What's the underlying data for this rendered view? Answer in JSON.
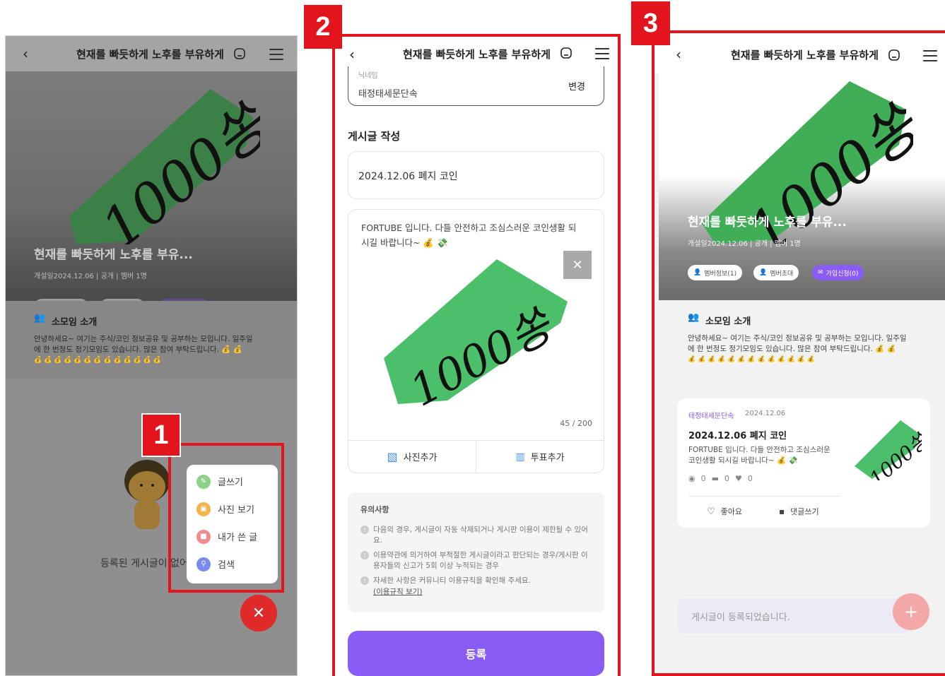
{
  "header": {
    "back": "‹",
    "title": "현재를 빠듯하게 노후를 부유하게"
  },
  "steps": [
    "1",
    "2",
    "3"
  ],
  "banner": {
    "title": "현재를 빠듯하게 노후를 부유...",
    "meta": "개설일2024.12.06  |  공개  |  멤버 1명",
    "member_info": "멤버정보(1)",
    "member_invite": "멤버초대",
    "join_request": "가입신청(0)"
  },
  "intro": {
    "title": "소모임 소개",
    "desc_line1": "안녕하세요~ 여기는 주식/코인 정보공유 및 공부하는 모입니다. 일주일",
    "desc_line2": "에 한 번정도 정기모임도 있습니다. 많은 참여 부탁드립니다. 💰 💰",
    "desc_line3": "💰 💰 💰 💰 💰 💰 💰 💰 💰 💰 💰 💰 💰"
  },
  "panel1": {
    "empty_text": "등록된 게시글이 없어",
    "fab_menu": [
      {
        "label": "글쓰기",
        "color": "#8fd18a",
        "glyph": "✎"
      },
      {
        "label": "사진 보기",
        "color": "#f6b24b",
        "glyph": "▣"
      },
      {
        "label": "내가 쓴 글",
        "color": "#f28b8b",
        "glyph": "■"
      },
      {
        "label": "검색",
        "color": "#7b8cf0",
        "glyph": "⚲"
      }
    ],
    "fab_close": "✕"
  },
  "panel2": {
    "nickname_label": "닉네임",
    "nickname_value": "태정태세문단속",
    "nickname_change": "변경",
    "section_title": "게시글 작성",
    "post_title": "2024.12.06 폐지 코인",
    "post_body_line1": "FORTUBE 입니다. 다들 안전하고 조심스러운 코인생활 되",
    "post_body_line2": "시길 바랍니다~ 💰 💸",
    "char_count": "45 / 200",
    "remove_image": "✕",
    "add_photo": "사진추가",
    "add_poll": "투표추가",
    "notice_title": "유의사항",
    "notices": [
      "다음의 경우, 게시글이 자동 삭제되거나 게시판 이용이 제한될 수 있어요.",
      "이용약관에 의거하여 부적절한 게시글이라고 판단되는 경우/게시판 이용자들의 신고가 5회 이상 누적되는 경우",
      "자세한 사항은 커뮤니티 이용규칙을 확인해 주세요."
    ],
    "rules_link": "(이용규칙 보기)",
    "submit": "등록"
  },
  "panel3": {
    "post_author": "태정태세문단속",
    "post_date": "2024.12.06",
    "post_title": "2024.12.06 폐지 코인",
    "post_body_line1": "FORTUBE 입니다. 다들 안전하고 조심스러운",
    "post_body_line2": "코인생활 되시길 바랍니다~ 💰 💸",
    "views": "0",
    "comments": "0",
    "likes": "0",
    "like_btn": "좋아요",
    "comment_btn": "댓글쓰기",
    "toast": "게시글이 등록되었습니다.",
    "fab_plus": "+"
  },
  "colors": {
    "accent": "#8a5cf6",
    "red": "#e3141c",
    "green": "#3fae56"
  },
  "stamp_text": "1000쏭"
}
